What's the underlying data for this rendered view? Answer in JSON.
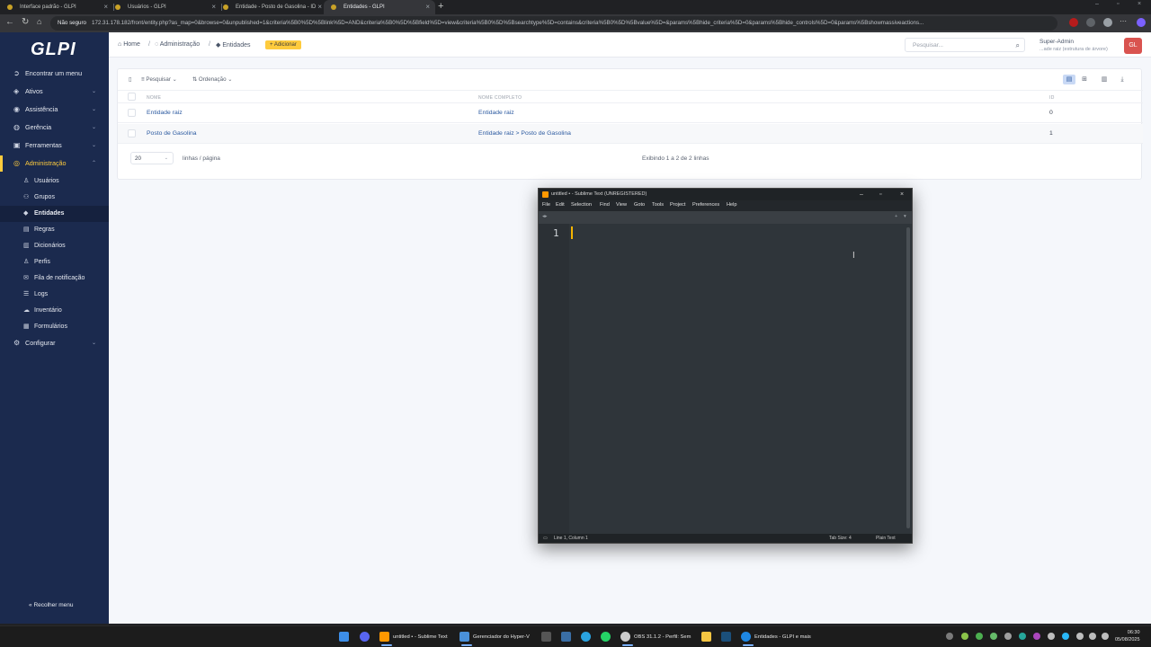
{
  "browser": {
    "tabs": [
      {
        "label": "Interface padrão - GLPI",
        "active": false
      },
      {
        "label": "Usuários - GLPI",
        "active": false
      },
      {
        "label": "Entidade - Posto de Gasolina - ID",
        "active": false
      },
      {
        "label": "Entidades - GLPI",
        "active": true
      }
    ],
    "security_label": "Não seguro",
    "url": "172.31.178.182/front/entity.php?as_map=0&browse=0&unpublished=1&criteria%5B0%5D%5Blink%5D=AND&criteria%5B0%5D%5Bfield%5D=view&criteria%5B0%5D%5Bsearchtype%5D=contains&criteria%5B0%5D%5Bvalue%5D=&params%5Bhide_criteria%5D=0&params%5Bhide_controls%5D=0&params%5Bshowmassiveactions..."
  },
  "sidebar": {
    "logo": "GLPI",
    "find_menu": "Encontrar um menu",
    "items": [
      {
        "label": "Ativos",
        "icon": "package-icon"
      },
      {
        "label": "Assistência",
        "icon": "headset-icon"
      },
      {
        "label": "Gerência",
        "icon": "wallet-icon"
      },
      {
        "label": "Ferramentas",
        "icon": "briefcase-icon"
      },
      {
        "label": "Administração",
        "icon": "shield-icon"
      }
    ],
    "subitems": [
      {
        "label": "Usuários",
        "icon": "user-icon"
      },
      {
        "label": "Grupos",
        "icon": "users-icon"
      },
      {
        "label": "Entidades",
        "icon": "stack-icon"
      },
      {
        "label": "Regras",
        "icon": "book-icon"
      },
      {
        "label": "Dicionários",
        "icon": "dictionary-icon"
      },
      {
        "label": "Perfis",
        "icon": "profile-icon"
      },
      {
        "label": "Fila de notificação",
        "icon": "mail-queue-icon"
      },
      {
        "label": "Logs",
        "icon": "logs-icon"
      },
      {
        "label": "Inventário",
        "icon": "cloud-icon"
      },
      {
        "label": "Formulários",
        "icon": "forms-icon"
      }
    ],
    "configurar": "Configurar",
    "collapse": "Recolher menu"
  },
  "topbar": {
    "breadcrumb": [
      "Home",
      "Administração",
      "Entidades"
    ],
    "add_label": "Adicionar",
    "search_placeholder": "Pesquisar...",
    "user_name": "Super-Admin",
    "user_entity": "...ade raiz (estrutura de árvore)",
    "avatar_initials": "GL"
  },
  "list": {
    "search_label": "Pesquisar",
    "sort_label": "Ordenação",
    "columns": [
      "Nome",
      "Nome completo",
      "ID"
    ],
    "rows": [
      {
        "name": "Entidade raiz",
        "full": "Entidade raiz",
        "id": "0"
      },
      {
        "name": "Posto de Gasolina",
        "full": "Entidade raiz > Posto de Gasolina",
        "id": "1"
      }
    ],
    "per_page": "20",
    "per_page_label": "linhas / página",
    "showing": "Exibindo 1 a 2 de 2 linhas"
  },
  "sublime": {
    "title": "untitled • - Sublime Text (UNREGISTERED)",
    "menu": [
      "File",
      "Edit",
      "Selection",
      "Find",
      "View",
      "Goto",
      "Tools",
      "Project",
      "Preferences",
      "Help"
    ],
    "line_number": "1",
    "status_position": "Line 1, Column 1",
    "status_tab": "Tab Size: 4",
    "status_syntax": "Plain Text"
  },
  "taskbar": {
    "apps": [
      {
        "label": "untitled • - Sublime Text",
        "color": "#ff9800"
      },
      {
        "label": "Gerenciador do Hyper-V",
        "color": "#4a90d9"
      },
      {
        "label": "OBS 31.1.2 - Perfil: Sem",
        "color": "#cccccc"
      },
      {
        "label": "Entidades - GLPI e mais",
        "color": "#1e88e5"
      }
    ],
    "time": "06:30",
    "date": "05/08/2025"
  },
  "colors": {
    "accent": "#fecb3d",
    "sidebar": "#1b2a4e",
    "link": "#2c5aa0"
  }
}
